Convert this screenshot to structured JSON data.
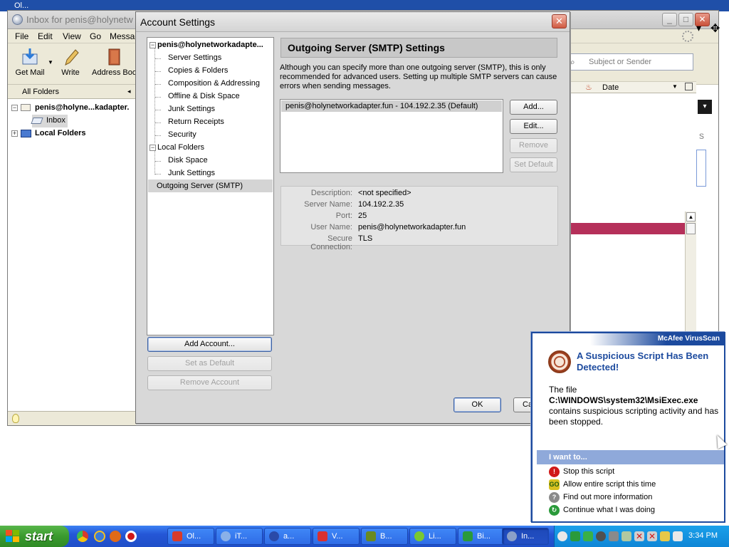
{
  "background_app": {
    "title": "Inbox for penis@holynetw",
    "top_strip_title": "Ol...",
    "menu": [
      "File",
      "Edit",
      "View",
      "Go",
      "Messag"
    ],
    "toolbar": {
      "get_mail": "Get Mail",
      "write": "Write",
      "address_book": "Address Boo"
    },
    "folder_header": "All Folders",
    "folders": {
      "account": "penis@holyne...kadapter.",
      "inbox": "Inbox",
      "local": "Local Folders"
    },
    "search_placeholder": "Subject or Sender",
    "column_date": "Date",
    "partial_text": "s"
  },
  "dialog": {
    "title": "Account Settings",
    "tree": {
      "account": "penis@holynetworkadapte...",
      "items": [
        "Server Settings",
        "Copies & Folders",
        "Composition & Addressing",
        "Offline & Disk Space",
        "Junk Settings",
        "Return Receipts",
        "Security"
      ],
      "local_folders": "Local Folders",
      "local_items": [
        "Disk Space",
        "Junk Settings"
      ],
      "outgoing": "Outgoing Server (SMTP)"
    },
    "buttons": {
      "add_account": "Add Account...",
      "set_default": "Set as Default",
      "remove_account": "Remove Account",
      "ok": "OK",
      "cancel": "Ca"
    },
    "smtp": {
      "header": "Outgoing Server (SMTP) Settings",
      "description": "Although you can specify more than one outgoing server (SMTP), this is only recommended for advanced users. Setting up multiple SMTP servers can cause errors when sending messages.",
      "servers": [
        "penis@holynetworkadapter.fun - 104.192.2.35 (Default)"
      ],
      "buttons": {
        "add": "Add...",
        "edit": "Edit...",
        "remove": "Remove",
        "set_default": "Set Default"
      },
      "details": {
        "description_label": "Description:",
        "description_value": "<not specified>",
        "server_label": "Server Name:",
        "server_value": "104.192.2.35",
        "port_label": "Port:",
        "port_value": "25",
        "user_label": "User Name:",
        "user_value": "penis@holynetworkadapter.fun",
        "secure_label": "Secure Connection:",
        "secure_value": "TLS"
      }
    }
  },
  "mcafee": {
    "brand": "McAfee VirusScan",
    "headline": "A Suspicious Script Has Been Detected!",
    "body_prefix": "The file",
    "file_path": "C:\\WINDOWS\\system32\\MsiExec.exe",
    "body_suffix": "contains suspicious scripting activity and has been stopped.",
    "i_want_to": "I want to...",
    "options": [
      "Stop this script",
      "Allow entire script this time",
      "Find out more information",
      "Continue what I was doing"
    ]
  },
  "taskbar": {
    "start": "start",
    "tasks": [
      "Ol...",
      "iT...",
      "a...",
      "V...",
      "B...",
      "Li...",
      "Bi...",
      "In..."
    ],
    "clock": "3:34 PM"
  },
  "colors": {
    "accent_blue": "#1c4a9e",
    "taskbar_blue": "#2456d6",
    "start_green": "#3a9a2e",
    "alert_red_row": "#b5305a"
  }
}
